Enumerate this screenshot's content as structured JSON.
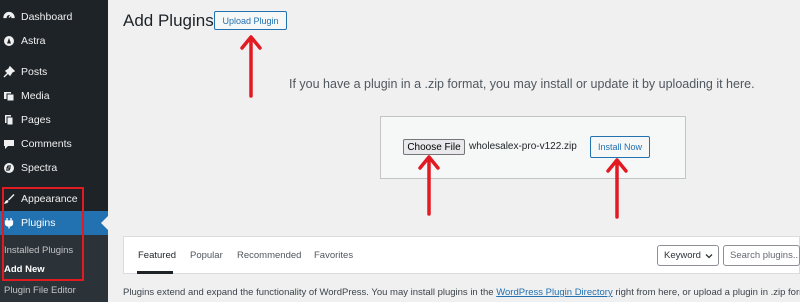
{
  "sidebar": {
    "items": [
      {
        "label": "Dashboard",
        "icon": "dashboard-icon"
      },
      {
        "label": "Astra",
        "icon": "astra-icon"
      },
      {
        "label": "Posts",
        "icon": "pin-icon"
      },
      {
        "label": "Media",
        "icon": "media-icon"
      },
      {
        "label": "Pages",
        "icon": "pages-icon"
      },
      {
        "label": "Comments",
        "icon": "comment-icon"
      },
      {
        "label": "Spectra",
        "icon": "spectra-icon"
      },
      {
        "label": "Appearance",
        "icon": "brush-icon"
      },
      {
        "label": "Plugins",
        "icon": "plug-icon"
      }
    ],
    "sub_items": [
      "Installed Plugins",
      "Add New",
      "Plugin File Editor"
    ]
  },
  "header": {
    "title": "Add Plugins",
    "upload_label": "Upload Plugin"
  },
  "upload": {
    "help_text": "If you have a plugin in a .zip format, you may install or update it by uploading it here.",
    "choose_label": "Choose File",
    "file_name": "wholesalex-pro-v122.zip",
    "install_label": "Install Now"
  },
  "filter": {
    "tabs": [
      "Featured",
      "Popular",
      "Recommended",
      "Favorites"
    ],
    "keyword_label": "Keyword",
    "search_placeholder": "Search plugins..."
  },
  "description": {
    "before": "Plugins extend and expand the functionality of WordPress. You may install plugins in the ",
    "link": "WordPress Plugin Directory",
    "after": " right from here, or upload a plugin in .zip format"
  },
  "colors": {
    "sidebar_bg": "#1d2327",
    "accent": "#2271b1",
    "annotation_red": "#e21b23"
  }
}
